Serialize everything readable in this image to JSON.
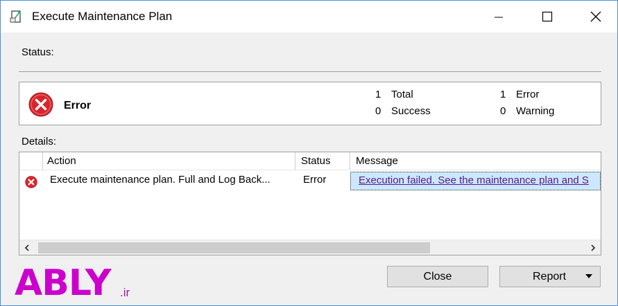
{
  "window": {
    "title": "Execute Maintenance Plan",
    "icon": "maintenance-plan-icon",
    "controls": [
      "minimize",
      "maximize",
      "close"
    ]
  },
  "status_section": {
    "label": "Status:",
    "state": "Error",
    "state_icon": "error-circle-icon",
    "counts": {
      "total_value": "1",
      "total_label": "Total",
      "success_value": "0",
      "success_label": "Success",
      "error_value": "1",
      "error_label": "Error",
      "warning_value": "0",
      "warning_label": "Warning"
    }
  },
  "details_section": {
    "label": "Details:",
    "columns": [
      "Action",
      "Status",
      "Message"
    ],
    "rows": [
      {
        "icon": "error-circle-icon",
        "action": "Execute maintenance plan. Full and Log Back...",
        "status": "Error",
        "message": "Execution failed. See the maintenance plan and S"
      }
    ]
  },
  "buttons": {
    "close": "Close",
    "report": "Report"
  },
  "watermark": {
    "brand": "ABLY",
    "suffix": ".ir"
  },
  "colors": {
    "error_red": "#d9262c",
    "selection": "#cce8ff",
    "link": "#551a8b",
    "watermark": "#cc00cc"
  }
}
